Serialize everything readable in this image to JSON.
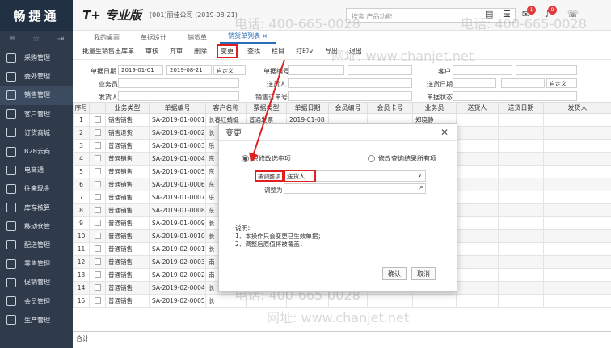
{
  "brand": "畅捷通",
  "product": "T+ 专业版",
  "company": "[001]丽佳公司 (2019-08-21)",
  "search_placeholder": "搜索 产品功能",
  "badges": [
    "1",
    "9"
  ],
  "sidebar": {
    "items": [
      {
        "label": "采购管理"
      },
      {
        "label": "委外管理"
      },
      {
        "label": "销售管理"
      },
      {
        "label": "客户管理"
      },
      {
        "label": "订货商城"
      },
      {
        "label": "B2B云商"
      },
      {
        "label": "电商通"
      },
      {
        "label": "往来现金"
      },
      {
        "label": "库存核算"
      },
      {
        "label": "移动仓管"
      },
      {
        "label": "配送管理"
      },
      {
        "label": "零售管理"
      },
      {
        "label": "促销管理"
      },
      {
        "label": "会员管理"
      },
      {
        "label": "生产管理"
      }
    ]
  },
  "tabs": [
    {
      "label": "我的桌面"
    },
    {
      "label": "单据设计"
    },
    {
      "label": "销货单"
    },
    {
      "label": "销货单列表 ×"
    }
  ],
  "toolbar": [
    "批量生销售出库单",
    "审核",
    "弃审",
    "删除",
    "变更",
    "查找",
    "栏目",
    "打印∨",
    "导出",
    "退出"
  ],
  "filters": {
    "date_label": "单据日期",
    "date_from": "2019-01-01",
    "date_to": "2019-08-21",
    "date_mode": "自定义",
    "doc_no_label": "单据编号",
    "customer_label": "客户",
    "salesman_label": "业务员",
    "sender_label": "送货人",
    "delivery_date_label": "送货日期",
    "delivery_mode": "自定义",
    "shipper_label": "发货人",
    "order_no_label": "销售订单号",
    "source_label": "单据状态"
  },
  "grid": {
    "columns": [
      "序号",
      "",
      "业务类型",
      "单据编号",
      "客户名称",
      "票据类型",
      "单据日期",
      "会员编号",
      "会员卡号",
      "业务员",
      "送货人",
      "送货日期",
      "发货人"
    ],
    "rows": [
      {
        "n": "1",
        "type": "销售销售",
        "no": "SA-2019-01-0001",
        "cust": "长春红蜻蜓",
        "bill": "普通发票",
        "date": "2019-01-08",
        "sales": "郑晓静"
      },
      {
        "n": "2",
        "type": "销售退货",
        "no": "SA-2019-01-0002",
        "cust": "长",
        "bill": "",
        "date": "",
        "sales": ""
      },
      {
        "n": "3",
        "type": "普通销售",
        "no": "SA-2019-01-0003",
        "cust": "乐",
        "bill": "",
        "date": "",
        "sales": ""
      },
      {
        "n": "4",
        "type": "普通销售",
        "no": "SA-2019-01-0004",
        "cust": "东",
        "bill": "",
        "date": "",
        "sales": ""
      },
      {
        "n": "5",
        "type": "普通销售",
        "no": "SA-2019-01-0005",
        "cust": "东",
        "bill": "",
        "date": "",
        "sales": ""
      },
      {
        "n": "6",
        "type": "普通销售",
        "no": "SA-2019-01-0006",
        "cust": "东",
        "bill": "",
        "date": "",
        "sales": ""
      },
      {
        "n": "7",
        "type": "普通销售",
        "no": "SA-2019-01-0007",
        "cust": "乐",
        "bill": "",
        "date": "",
        "sales": ""
      },
      {
        "n": "8",
        "type": "普通销售",
        "no": "SA-2019-01-0008",
        "cust": "东",
        "bill": "",
        "date": "",
        "sales": ""
      },
      {
        "n": "9",
        "type": "普通销售",
        "no": "SA-2019-01-0009",
        "cust": "长",
        "bill": "",
        "date": "",
        "sales": ""
      },
      {
        "n": "10",
        "type": "普通销售",
        "no": "SA-2019-01-0010",
        "cust": "长",
        "bill": "",
        "date": "",
        "sales": ""
      },
      {
        "n": "11",
        "type": "普通销售",
        "no": "SA-2019-02-0001",
        "cust": "长",
        "bill": "",
        "date": "",
        "sales": ""
      },
      {
        "n": "12",
        "type": "普通销售",
        "no": "SA-2019-02-0003",
        "cust": "南",
        "bill": "",
        "date": "",
        "sales": ""
      },
      {
        "n": "13",
        "type": "普通销售",
        "no": "SA-2019-02-0002",
        "cust": "南",
        "bill": "",
        "date": "",
        "sales": ""
      },
      {
        "n": "14",
        "type": "普通销售",
        "no": "SA-2019-02-0004",
        "cust": "长",
        "bill": "",
        "date": "",
        "sales": ""
      },
      {
        "n": "15",
        "type": "普通销售",
        "no": "SA-2019-02-0005",
        "cust": "长",
        "bill": "",
        "date": "",
        "sales": ""
      }
    ],
    "total_label": "合计"
  },
  "dialog": {
    "title": "变更",
    "radio_selected": "只修改选中项",
    "radio_other": "修改查询结果所有项",
    "field_label": "被调整项",
    "field_value": "送货人",
    "adjust_label": "调整为",
    "note_title": "说明：",
    "note_1": "1、本操作只会变更已生效单据；",
    "note_2": "2、调整后原值将被覆盖；",
    "ok": "确认",
    "cancel": "取消"
  },
  "watermark": {
    "phone": "电话: 400-665-0028",
    "site": "网址: www.chanjet.net"
  }
}
